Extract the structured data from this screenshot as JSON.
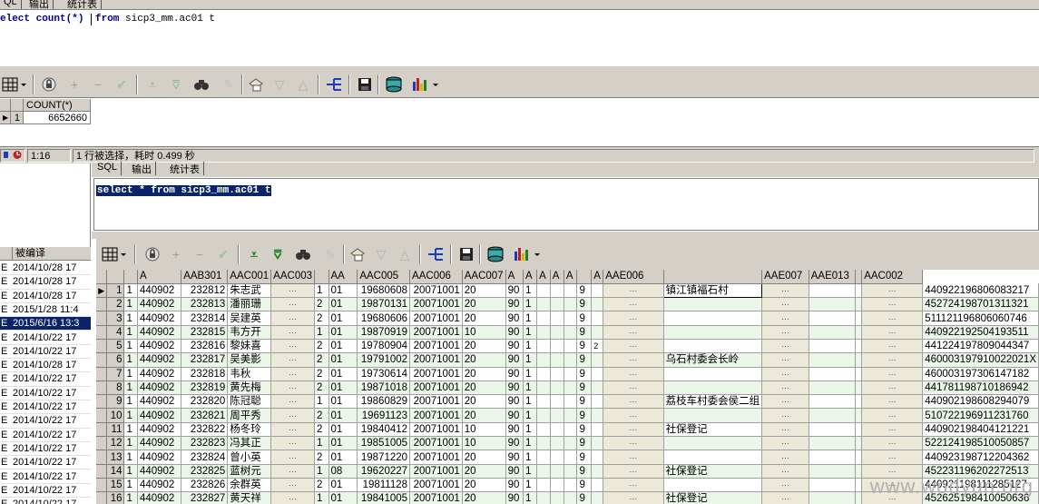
{
  "top_tabs": [
    "QL",
    "输出",
    "统计表"
  ],
  "top_sql": {
    "kw1": "elect count(*)",
    "kw2": "from",
    "rest": " sicp3_mm.ac01 t"
  },
  "count_result": {
    "column": "COUNT(*)",
    "row_number": "1",
    "value": "6652660"
  },
  "status": {
    "position": "1:16",
    "message": "1 行被选择，耗时 0.499 秒"
  },
  "lower_tabs": [
    "SQL",
    "输出",
    "统计表"
  ],
  "lower_sql": "select * from sicp3_mm.ac01 t",
  "left_panel": {
    "header": "被编译",
    "rows": [
      {
        "flag": "E",
        "date": "2014/10/28 17"
      },
      {
        "flag": "E",
        "date": "2014/10/28 17"
      },
      {
        "flag": "E",
        "date": "2014/10/28 17"
      },
      {
        "flag": "E",
        "date": "2015/1/28 11:4"
      },
      {
        "flag": "E",
        "date": "2015/6/16 13:3",
        "selected": true
      },
      {
        "flag": "E",
        "date": "2014/10/22 17"
      },
      {
        "flag": "E",
        "date": "2014/10/22 17"
      },
      {
        "flag": "E",
        "date": "2014/10/28 17"
      },
      {
        "flag": "E",
        "date": "2014/10/22 17"
      },
      {
        "flag": "E",
        "date": "2014/10/22 17"
      },
      {
        "flag": "E",
        "date": "2014/10/22 17"
      },
      {
        "flag": "E",
        "date": "2014/10/22 17"
      },
      {
        "flag": "E",
        "date": "2014/10/22 17"
      },
      {
        "flag": "E",
        "date": "2014/10/22 17"
      },
      {
        "flag": "E",
        "date": "2014/10/22 17"
      },
      {
        "flag": "E",
        "date": "2014/10/22 17"
      },
      {
        "flag": "E",
        "date": "2014/10/22 17"
      },
      {
        "flag": "E",
        "date": "2014/10/22 17"
      }
    ]
  },
  "grid": {
    "columns": [
      "",
      "",
      "A",
      "AAB301",
      "AAC001",
      "AAC003",
      "",
      "AA",
      "AAC005",
      "AAC006",
      "AAC007",
      "A",
      "A",
      "A",
      "A",
      "A",
      "",
      "A",
      "AAE006",
      "",
      "AAE007",
      "AAE013",
      "",
      "AAC002"
    ],
    "rows": [
      [
        "1",
        "1",
        "440902",
        "232812",
        "朱志武",
        "1",
        "01",
        "19680608",
        "20071001",
        "20",
        "90",
        "1",
        "9",
        "",
        "镇江镇福石村",
        "",
        "",
        "",
        "440922196806083217"
      ],
      [
        "2",
        "1",
        "440902",
        "232813",
        "潘丽珊",
        "2",
        "01",
        "19870131",
        "20071001",
        "20",
        "90",
        "1",
        "9",
        "",
        "",
        "",
        "",
        "",
        "452724198701311321"
      ],
      [
        "3",
        "1",
        "440902",
        "232814",
        "吴建英",
        "2",
        "01",
        "19680606",
        "20071001",
        "20",
        "90",
        "1",
        "9",
        "",
        "",
        "",
        "",
        "",
        "511121196806060746"
      ],
      [
        "4",
        "1",
        "440902",
        "232815",
        "韦方开",
        "1",
        "01",
        "19870919",
        "20071001",
        "10",
        "90",
        "1",
        "9",
        "",
        "",
        "",
        "",
        "",
        "440922192504193511"
      ],
      [
        "5",
        "1",
        "440902",
        "232816",
        "黎妹喜",
        "2",
        "01",
        "19780904",
        "20071001",
        "20",
        "90",
        "1",
        "9",
        "2",
        "",
        "",
        "",
        "",
        "441224197809044347"
      ],
      [
        "6",
        "1",
        "440902",
        "232817",
        "吴美影",
        "2",
        "01",
        "19791002",
        "20071001",
        "20",
        "90",
        "1",
        "9",
        "",
        "乌石村委会长岭",
        "",
        "",
        "",
        "460003197910022021X"
      ],
      [
        "7",
        "1",
        "440902",
        "232818",
        "韦秋",
        "2",
        "01",
        "19730614",
        "20071001",
        "20",
        "90",
        "1",
        "9",
        "",
        "",
        "",
        "",
        "",
        "460003197306147182"
      ],
      [
        "8",
        "1",
        "440902",
        "232819",
        "黄先梅",
        "2",
        "01",
        "19871018",
        "20071001",
        "20",
        "90",
        "1",
        "9",
        "",
        "",
        "",
        "",
        "",
        "441781198710186942"
      ],
      [
        "9",
        "1",
        "440902",
        "232820",
        "陈冠聪",
        "1",
        "01",
        "19860829",
        "20071001",
        "20",
        "90",
        "1",
        "9",
        "",
        "荔枝车村委会侯二组",
        "",
        "",
        "",
        "440902198608294079"
      ],
      [
        "10",
        "1",
        "440902",
        "232821",
        "周平秀",
        "2",
        "01",
        "19691123",
        "20071001",
        "20",
        "90",
        "1",
        "9",
        "",
        "",
        "",
        "",
        "",
        "510722196911231760"
      ],
      [
        "11",
        "1",
        "440902",
        "232822",
        "杨冬玲",
        "2",
        "01",
        "19840412",
        "20071001",
        "10",
        "90",
        "1",
        "9",
        "",
        "社保登记",
        "",
        "",
        "",
        "440902198404121221"
      ],
      [
        "12",
        "1",
        "440902",
        "232823",
        "冯其正",
        "1",
        "01",
        "19851005",
        "20071001",
        "10",
        "90",
        "1",
        "9",
        "",
        "",
        "",
        "",
        "",
        "522124198510050857"
      ],
      [
        "13",
        "1",
        "440902",
        "232824",
        "曾小英",
        "2",
        "01",
        "19871220",
        "20071001",
        "20",
        "90",
        "1",
        "9",
        "",
        "",
        "",
        "",
        "",
        "440923198712204362"
      ],
      [
        "14",
        "1",
        "440902",
        "232825",
        "蓝树元",
        "1",
        "08",
        "19620227",
        "20071001",
        "20",
        "90",
        "1",
        "9",
        "",
        "社保登记",
        "",
        "",
        "",
        "452231196202272513"
      ],
      [
        "15",
        "1",
        "440902",
        "232826",
        "余群英",
        "2",
        "01",
        "19811128",
        "20071001",
        "20",
        "90",
        "1",
        "9",
        "",
        "",
        "",
        "",
        "",
        "440921198111285127"
      ],
      [
        "16",
        "1",
        "440902",
        "232827",
        "黄天祥",
        "1",
        "01",
        "19841005",
        "20071001",
        "20",
        "90",
        "1",
        "9",
        "",
        "社保登记",
        "",
        "",
        "",
        "452625198410050636"
      ]
    ]
  },
  "watermark": "www.wodyun.org"
}
